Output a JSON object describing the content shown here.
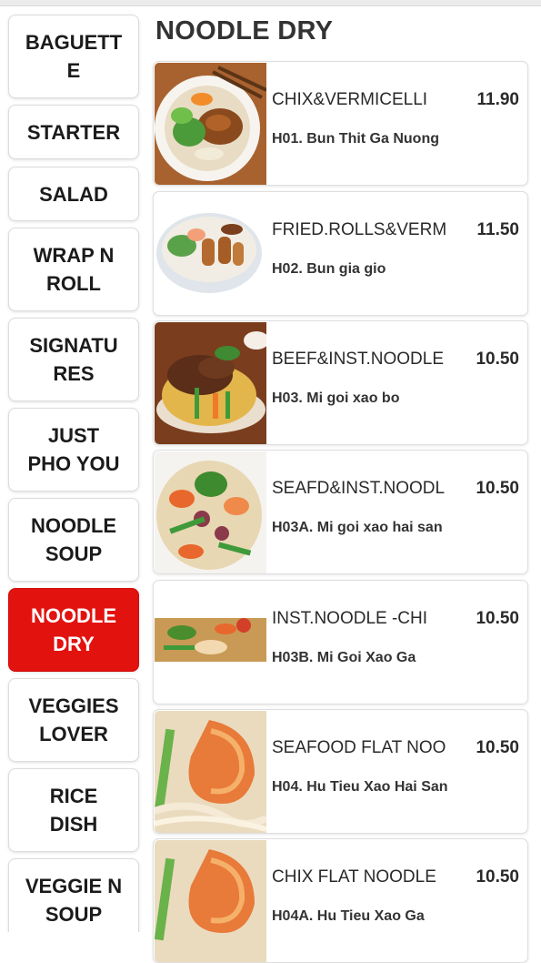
{
  "page_title": "NOODLE DRY",
  "categories": [
    {
      "label": "BAGUETT\nE"
    },
    {
      "label": "STARTER"
    },
    {
      "label": "SALAD"
    },
    {
      "label": "WRAP N\nROLL"
    },
    {
      "label": "SIGNATU\nRES"
    },
    {
      "label": "JUST\nPHO YOU"
    },
    {
      "label": "NOODLE\nSOUP"
    },
    {
      "label": "NOODLE\nDRY"
    },
    {
      "label": "VEGGIES\nLOVER"
    },
    {
      "label": "RICE\nDISH"
    },
    {
      "label": "VEGGIE N\nSOUP"
    }
  ],
  "active_category": "NOODLE DRY",
  "colors": {
    "active": "#e2120f"
  },
  "items": [
    {
      "name": "CHIX&VERMICELLI",
      "price": "11.90",
      "desc": "H01. Bun Thit Ga Nuong",
      "image": "grilled-chicken-vermicelli-bowl-photo"
    },
    {
      "name": "FRIED.ROLLS&VERM",
      "price": "11.50",
      "desc": "H02. Bun gia gio",
      "image": "spring-rolls-vermicelli-bowl-photo"
    },
    {
      "name": "BEEF&INST.NOODLE",
      "price": "10.50",
      "desc": "H03. Mi goi xao bo",
      "image": "beef-fried-noodle-photo"
    },
    {
      "name": "SEAFD&INST.NOODL",
      "price": "10.50",
      "desc": "H03A. Mi goi xao hai san",
      "image": "seafood-fried-noodle-photo"
    },
    {
      "name": "INST.NOODLE -CHI",
      "price": "10.50",
      "desc": "H03B. Mi Goi Xao Ga",
      "image": "chicken-fried-noodle-photo"
    },
    {
      "name": "SEAFOOD FLAT NOO",
      "price": "10.50",
      "desc": "H04. Hu Tieu Xao Hai San",
      "image": "seafood-flat-noodle-photo"
    },
    {
      "name": "CHIX FLAT NOODLE",
      "price": "10.50",
      "desc": "H04A. Hu Tieu Xao Ga",
      "image": "chicken-flat-noodle-photo"
    }
  ]
}
